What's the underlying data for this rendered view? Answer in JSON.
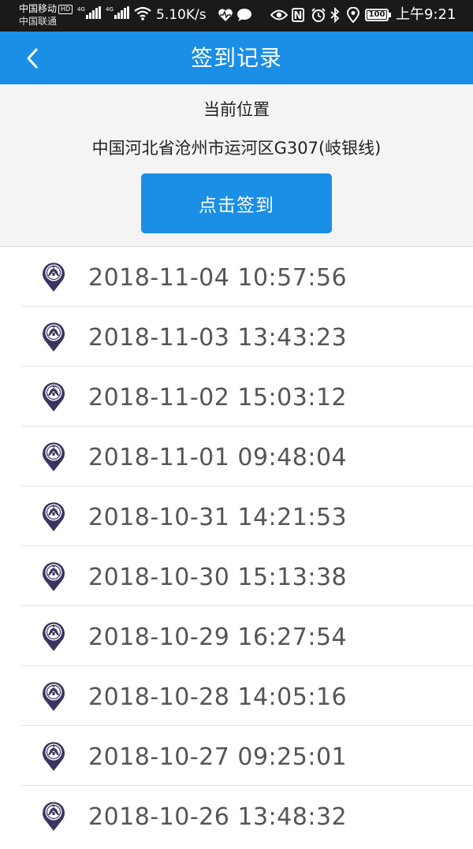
{
  "status_bar": {
    "carrier_1": "中国移动",
    "carrier_1_badge": "HD",
    "carrier_2": "中国联通",
    "network_1": "4G",
    "network_2": "4G",
    "net_speed": "5.10K/s",
    "nfc_label": "N",
    "battery": "100",
    "time": "上午9:21",
    "icons": [
      "signal-icon",
      "wifi-icon",
      "heartbeat-icon",
      "chat-icon",
      "eye-icon",
      "nfc-icon",
      "alarm-icon",
      "bluetooth-icon",
      "location-icon",
      "battery-icon"
    ]
  },
  "header": {
    "title": "签到记录",
    "back_icon": "chevron-left-icon"
  },
  "location": {
    "label": "当前位置",
    "address": "中国河北省沧州市运河区G307(岐银线)"
  },
  "checkin_button": {
    "label": "点击签到"
  },
  "records": [
    {
      "time": "2018-11-04 10:57:56",
      "icon": "location-pin-icon"
    },
    {
      "time": "2018-11-03 13:43:23",
      "icon": "location-pin-icon"
    },
    {
      "time": "2018-11-02 15:03:12",
      "icon": "location-pin-icon"
    },
    {
      "time": "2018-11-01 09:48:04",
      "icon": "location-pin-icon"
    },
    {
      "time": "2018-10-31 14:21:53",
      "icon": "location-pin-icon"
    },
    {
      "time": "2018-10-30 15:13:38",
      "icon": "location-pin-icon"
    },
    {
      "time": "2018-10-29 16:27:54",
      "icon": "location-pin-icon"
    },
    {
      "time": "2018-10-28 14:05:16",
      "icon": "location-pin-icon"
    },
    {
      "time": "2018-10-27 09:25:01",
      "icon": "location-pin-icon"
    },
    {
      "time": "2018-10-26 13:48:32",
      "icon": "location-pin-icon"
    }
  ],
  "colors": {
    "primary": "#1b8ee6",
    "status_bar": "#1a1a1a",
    "panel_bg": "#f4f4f4",
    "record_text": "#555555",
    "pin_icon": "#3a3460"
  }
}
